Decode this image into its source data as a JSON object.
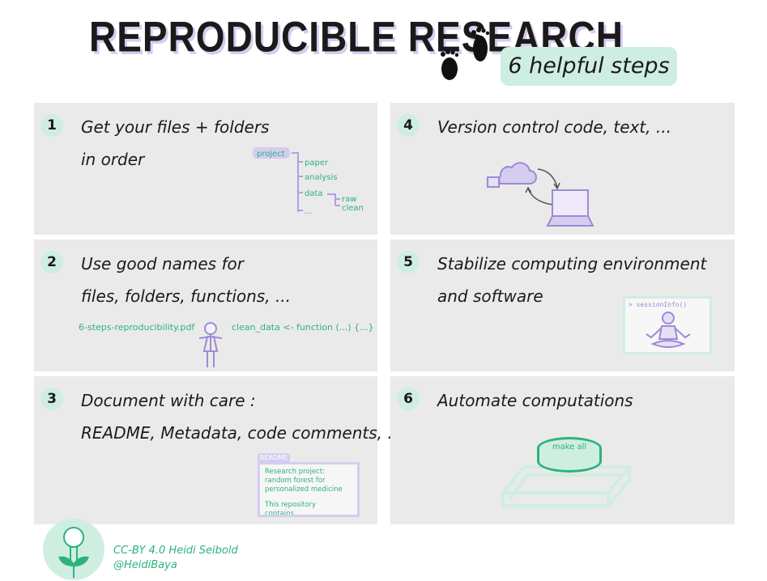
{
  "title": "REPRODUCIBLE RESEARCH",
  "subtitle": "6 helpful steps",
  "steps": [
    {
      "number": "1",
      "line1": "Get your files + folders",
      "line2": "in order",
      "tree": {
        "root": "project",
        "items": [
          "paper",
          "analysis",
          "data",
          "..."
        ],
        "data_children": [
          "raw",
          "clean"
        ]
      }
    },
    {
      "number": "2",
      "line1": "Use good names for",
      "line2": "files, folders, functions, ...",
      "example_file": "6-steps-reproducibility.pdf",
      "example_function": "clean_data <- function (...) {...}"
    },
    {
      "number": "3",
      "line1": "Document with care :",
      "line2": "README, Metadata, code comments, ...",
      "readme_tab": "README",
      "readme_heading": "Research project: random forest for personalized medicine",
      "readme_body": "This repository contains..."
    },
    {
      "number": "4",
      "line1": "Version control code, text, ..."
    },
    {
      "number": "5",
      "line1": "Stabilize computing environment",
      "line2": "and software",
      "console": "> sessionInfo()"
    },
    {
      "number": "6",
      "line1": "Automate computations",
      "button_label": "make all"
    }
  ],
  "credit": {
    "license": "CC-BY 4.0 Heidi Seibold",
    "handle": "@HeidiBaya"
  },
  "colors": {
    "mint": "#cfeee2",
    "green": "#2db37a",
    "purple": "#9e8ad6",
    "card": "#eaeaea"
  }
}
